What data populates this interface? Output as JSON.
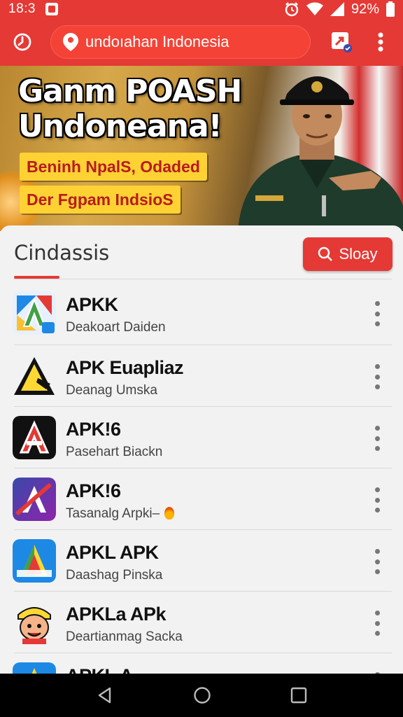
{
  "status": {
    "time": "18:3",
    "battery": "92%"
  },
  "browser": {
    "url": "undoıahan Indonesia"
  },
  "hero": {
    "title_line1": "Ganm POASH",
    "title_line2": "Undoneana!",
    "tag1": "Beninh NpalS, Odaded",
    "tag2": "Der Fgpam IndsioS"
  },
  "section": {
    "title": "Cindassis",
    "action_label": "Sloay"
  },
  "apps": [
    {
      "name": "APKK",
      "sub": "Deakoart Daiden",
      "icon": "apk-a-icon"
    },
    {
      "name": "APK Euapliaz",
      "sub": "Deanag Umska",
      "icon": "triangle-icon"
    },
    {
      "name": "APK!6",
      "sub": "Pasehart Biackn",
      "icon": "red-a-icon"
    },
    {
      "name": "APK!6",
      "sub": "Tasanalg Arpki–",
      "icon": "shuffle-a-icon"
    },
    {
      "name": "APKL APK",
      "sub": "Daashag Pinska",
      "icon": "appty-icon"
    },
    {
      "name": "APKLa APk",
      "sub": "Deartianmag Sacka",
      "icon": "cartoon-face-icon"
    },
    {
      "name": "APKL A...",
      "sub": "",
      "icon": "partial-icon"
    }
  ],
  "colors": {
    "accent": "#e53935",
    "panel": "#f2f2f2"
  }
}
